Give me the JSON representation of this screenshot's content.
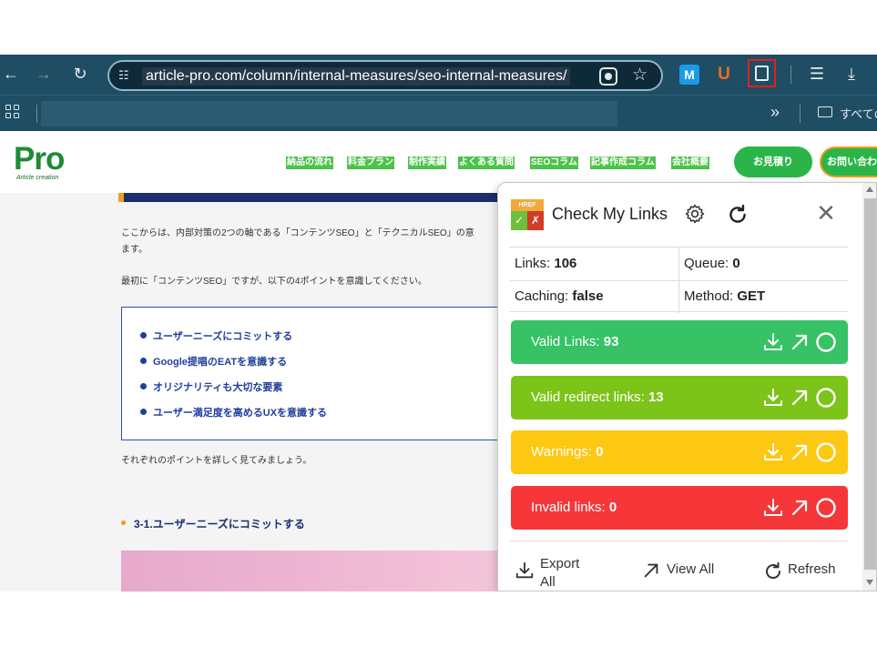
{
  "browser": {
    "url": "article-pro.com/column/internal-measures/seo-internal-measures/",
    "bookmarks_folder": "すべての"
  },
  "site": {
    "logo": "Pro",
    "logo_sub": "Article creation",
    "nav": [
      "納品の流れ",
      "料金プラン",
      "制作実績",
      "よくある質問",
      "SEOコラム",
      "記事作成コラム",
      "会社概要"
    ],
    "quote_button": "お見積り",
    "contact_button": "お問い合わ"
  },
  "article": {
    "intro_line1": "ここからは、内部対策の2つの軸である「コンテンツSEO」と「テクニカルSEO」の意",
    "intro_line2": "ます。",
    "lead": "最初に「コンテンツSEO」ですが、以下の4ポイントを意識してください。",
    "points": [
      "ユーザーニーズにコミットする",
      "Google提唱のEATを意識する",
      "オリジナリティも大切な要素",
      "ユーザー満足度を高めるUXを意識する"
    ],
    "outro": "それぞれのポイントを詳しく見てみましょう。",
    "subheading": "3-1.ユーザーニーズにコミットする"
  },
  "popup": {
    "logo_text": "HREF",
    "title": "Check My Links",
    "stats": {
      "links_label": "Links:",
      "links_value": "106",
      "queue_label": "Queue:",
      "queue_value": "0",
      "caching_label": "Caching:",
      "caching_value": "false",
      "method_label": "Method:",
      "method_value": "GET"
    },
    "bars": {
      "valid": {
        "label": "Valid Links:",
        "value": "93",
        "color": "#36c265"
      },
      "redirect": {
        "label": "Valid redirect links:",
        "value": "13",
        "color": "#7cc41a"
      },
      "warnings": {
        "label": "Warnings:",
        "value": "0",
        "color": "#fcc811"
      },
      "invalid": {
        "label": "Invalid links:",
        "value": "0",
        "color": "#f5373a"
      }
    },
    "footer": {
      "export_line1": "Export",
      "export_line2": "All",
      "view_all": "View All",
      "refresh": "Refresh"
    }
  }
}
